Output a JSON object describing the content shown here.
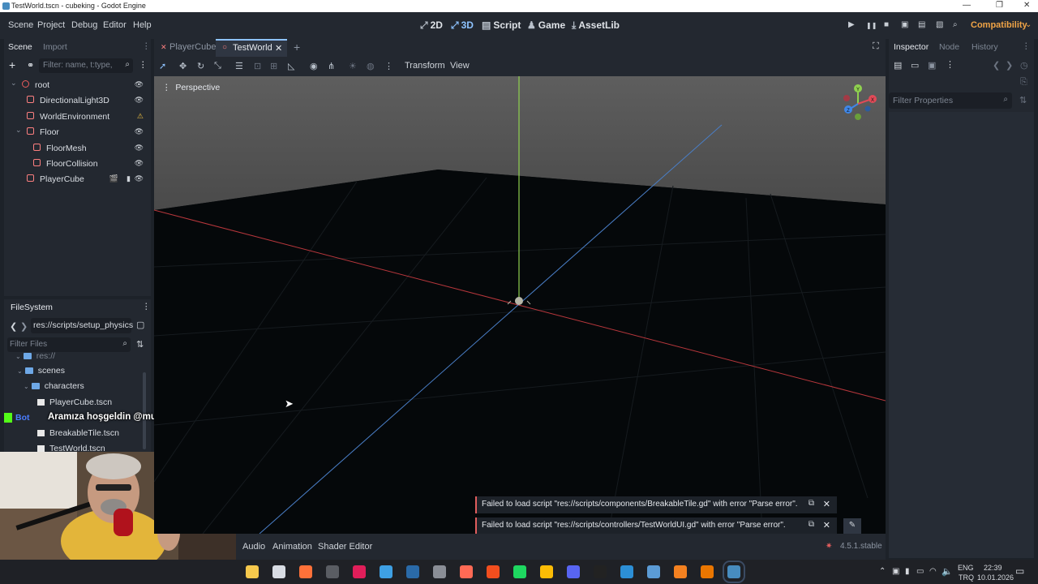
{
  "window": {
    "title": "TestWorld.tscn - cubeking - Godot Engine",
    "minimize": "—",
    "restore": "❐",
    "close": "✕"
  },
  "menu": [
    "Scene",
    "Project",
    "Debug",
    "Editor",
    "Help"
  ],
  "workspaces": [
    {
      "icon": "⤢",
      "label": "2D",
      "active": false
    },
    {
      "icon": "⤢",
      "label": "3D",
      "active": true
    },
    {
      "icon": "▤",
      "label": "Script",
      "active": false
    },
    {
      "icon": "♟",
      "label": "Game",
      "active": false
    },
    {
      "icon": "⤓",
      "label": "AssetLib",
      "active": false
    }
  ],
  "run_controls": {
    "play": "▶",
    "pause": "❚❚",
    "stop": "■",
    "renderer": "Compatibility"
  },
  "scene_dock": {
    "tabs": [
      "Scene",
      "Import"
    ],
    "filter_placeholder": "Filter: name, t:type,",
    "nodes": [
      {
        "label": "root",
        "depth": 0,
        "expander": "⌄",
        "icon_color": "#ea5c5c",
        "indicator": "👁"
      },
      {
        "label": "DirectionalLight3D",
        "depth": 1,
        "expander": "",
        "icon_color": "#fc7f7f",
        "indicator": "👁"
      },
      {
        "label": "WorldEnvironment",
        "depth": 1,
        "expander": "",
        "icon_color": "#fc7f7f",
        "indicator": "⚠"
      },
      {
        "label": "Floor",
        "depth": 1,
        "expander": "⌄",
        "icon_color": "#fc7f7f",
        "indicator": "👁"
      },
      {
        "label": "FloorMesh",
        "depth": 2,
        "expander": "",
        "icon_color": "#fc7f7f",
        "indicator": "👁"
      },
      {
        "label": "FloorCollision",
        "depth": 2,
        "expander": "",
        "icon_color": "#fc7f7f",
        "indicator": "👁"
      },
      {
        "label": "PlayerCube",
        "depth": 1,
        "expander": "",
        "icon_color": "#fc7f7f",
        "indicator": "👁"
      }
    ]
  },
  "filesystem": {
    "title": "FileSystem",
    "path": "res://scripts/setup_physics",
    "filter_placeholder": "Filter Files",
    "items": [
      {
        "label": "res://",
        "kind": "folder"
      },
      {
        "label": "scenes",
        "kind": "folder"
      },
      {
        "label": "characters",
        "kind": "folder"
      },
      {
        "label": "PlayerCube.tscn",
        "kind": "file"
      },
      {
        "label": "BreakableTile.tscn",
        "kind": "file"
      },
      {
        "label": "TestWorld.tscn",
        "kind": "file"
      }
    ]
  },
  "chat_overlay": {
    "badge": "Bot",
    "message": "Aramıza hoşgeldin @mustafa_dogukan"
  },
  "editor_tabs": [
    {
      "label": "PlayerCube",
      "active": false
    },
    {
      "label": "TestWorld",
      "active": true
    }
  ],
  "toolbar3d": {
    "transform": "Transform",
    "view": "View"
  },
  "viewport": {
    "label": "Perspective",
    "gizmo": {
      "x": "X",
      "y": "Y",
      "z": "Z"
    }
  },
  "notifications": [
    {
      "message": "Failed to load script \"res://scripts/components/BreakableTile.gd\" with error \"Parse error\"."
    },
    {
      "message": "Failed to load script \"res://scripts/controllers/TestWorldUI.gd\" with error \"Parse error\"."
    }
  ],
  "bottom_panel": {
    "tabs": [
      "Audio",
      "Animation",
      "Shader Editor"
    ],
    "version": "4.5.1.stable"
  },
  "inspector": {
    "tabs": [
      "Inspector",
      "Node",
      "History"
    ],
    "filter_placeholder": "Filter Properties"
  },
  "taskbar": {
    "apps": [
      "file-explorer",
      "clock",
      "firefox",
      "obs",
      "slack",
      "app-blue",
      "steam",
      "unity",
      "app-orange",
      "figma",
      "spotify",
      "chrome",
      "discord",
      "terminal",
      "vscode",
      "app-a",
      "cloud",
      "blender",
      "godot"
    ],
    "lang": "ENG",
    "lang2": "TRQ",
    "time": "22:39",
    "date": "10.01.2026"
  },
  "colors": {
    "accent": "#8ec3ff",
    "error": "#e05d5d",
    "warning": "#f0a446"
  }
}
